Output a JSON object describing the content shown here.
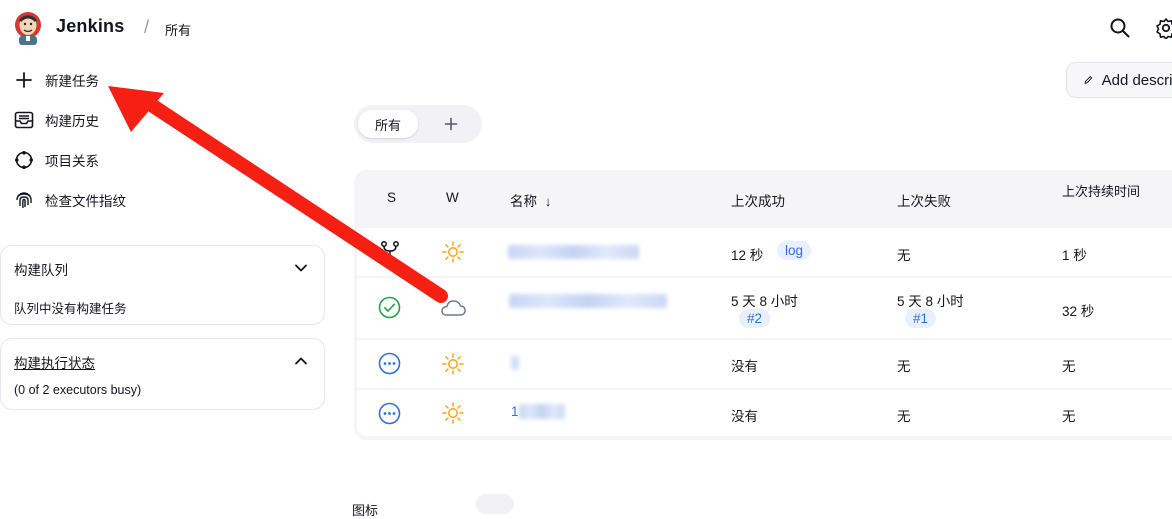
{
  "header": {
    "brand": "Jenkins",
    "separator": "/",
    "breadcrumb": "所有",
    "search_icon": "search-icon",
    "settings_icon": "gear-icon"
  },
  "sidebar": {
    "tasks": [
      {
        "label": "新建任务",
        "icon": "plus-icon"
      },
      {
        "label": "构建历史",
        "icon": "inbox-icon"
      },
      {
        "label": "项目关系",
        "icon": "relationship-icon"
      },
      {
        "label": "检查文件指纹",
        "icon": "fingerprint-icon"
      }
    ],
    "build_queue": {
      "title": "构建队列",
      "body": "队列中没有构建任务"
    },
    "executors": {
      "title": "构建执行状态",
      "body": "(0 of 2 executors busy)"
    }
  },
  "main": {
    "add_description": "Add description",
    "tabs": [
      {
        "label": "所有"
      }
    ],
    "add_tab_icon": "plus-icon",
    "table": {
      "headers": {
        "s": "S",
        "w": "W",
        "name": "名称",
        "sort": "↓",
        "last_success": "上次成功",
        "last_failure": "上次失败",
        "last_duration": "上次持续时间"
      },
      "rows": [
        {
          "status": "branch-icon",
          "weather": "sun-icon",
          "name": "",
          "last_success": "12 秒",
          "success_build": "log",
          "last_failure": "无",
          "failure_build": "",
          "duration": "1 秒"
        },
        {
          "status": "success-icon",
          "weather": "cloud-icon",
          "name": "",
          "last_success": "5 天 8 小时",
          "success_build": "#2",
          "last_failure": "5 天 8 小时",
          "failure_build": "#1",
          "duration": "32 秒"
        },
        {
          "status": "not-built-icon",
          "weather": "sun-icon",
          "name": "",
          "last_success": "没有",
          "success_build": "",
          "last_failure": "无",
          "failure_build": "",
          "duration": "无"
        },
        {
          "status": "not-built-icon",
          "weather": "sun-icon",
          "name": "1",
          "last_success": "没有",
          "success_build": "",
          "last_failure": "无",
          "failure_build": "",
          "duration": "无"
        }
      ]
    },
    "footer_text": "图标"
  },
  "annotation": {
    "color": "#f51f14"
  },
  "colors": {
    "link": "#2f6ee0",
    "success": "#1ea446",
    "sun": "#f3a712",
    "not_built": "#2f6ee0"
  }
}
